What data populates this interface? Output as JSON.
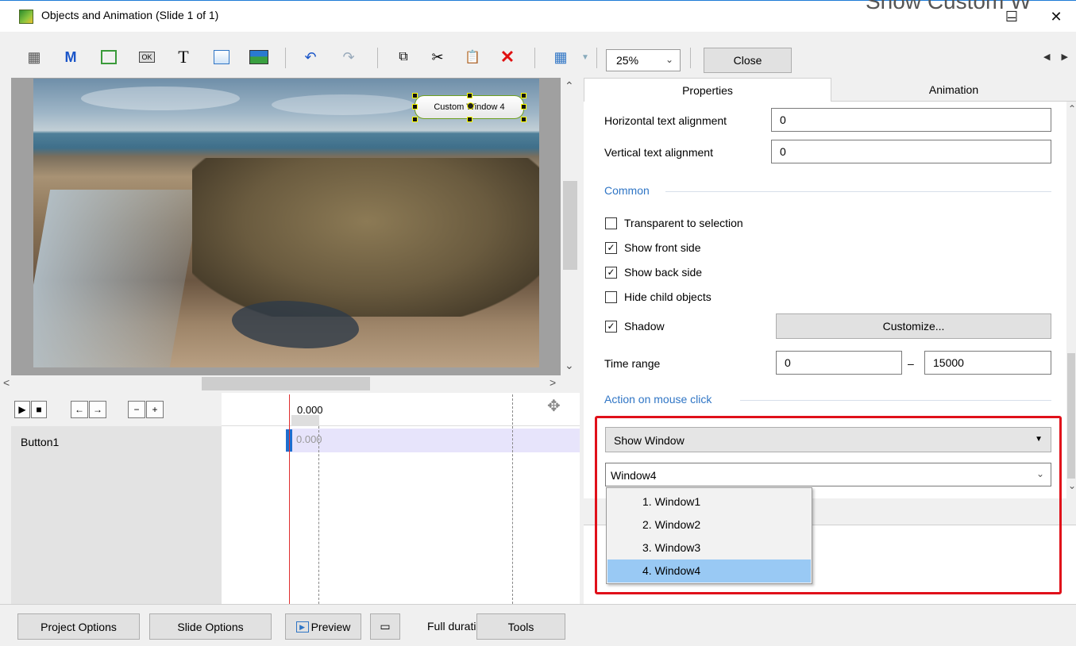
{
  "window": {
    "title": "Objects and Animation (Slide 1 of 1)",
    "minimize_glyph": "–",
    "maximize_glyph": "☐",
    "close_glyph": "✕",
    "background_app_text": "Show Custom W"
  },
  "toolbar": {
    "icons": [
      "camera-icon",
      "m-icon",
      "frame-icon",
      "ok-button-icon",
      "text-icon",
      "rectangle-icon",
      "image-icon",
      "undo-icon",
      "redo-icon",
      "copy-icon",
      "cut-icon",
      "paste-icon",
      "delete-icon",
      "grid-icon"
    ],
    "m_label": "M",
    "t_label": "T",
    "ok_label": "OK",
    "zoom_value": "25%",
    "close_label": "Close"
  },
  "canvas": {
    "object_label": "Custom Window 4"
  },
  "timeline": {
    "time_value": "0.000",
    "row_time": "0.000",
    "rows": [
      "Button1"
    ]
  },
  "tabs": {
    "properties": "Properties",
    "animation": "Animation"
  },
  "properties": {
    "h_align_label": "Horizontal text alignment",
    "h_align_value": "0",
    "v_align_label": "Vertical text alignment",
    "v_align_value": "0",
    "common_section": "Common",
    "transparent_label": "Transparent to selection",
    "transparent_checked": false,
    "front_label": "Show front side",
    "front_checked": true,
    "back_label": "Show back side",
    "back_checked": true,
    "hide_child_label": "Hide child objects",
    "hide_child_checked": false,
    "shadow_label": "Shadow",
    "shadow_checked": true,
    "customize_label": "Customize...",
    "time_range_label": "Time range",
    "time_start": "0",
    "time_dash": "–",
    "time_end": "15000",
    "action_section": "Action on mouse click",
    "action_value": "Show Window",
    "window_value": "Window4",
    "window_options": [
      "1. Window1",
      "2. Window2",
      "3. Window3",
      "4. Window4"
    ],
    "selected_option_index": 3
  },
  "bottom": {
    "project_options": "Project Options",
    "slide_options": "Slide Options",
    "preview": "Preview",
    "full_duration": "Full duration",
    "tools": "Tools"
  },
  "colors": {
    "highlight_red": "#e0101a",
    "section_blue": "#2f75c5",
    "selected_item": "#99c9f4",
    "playhead": "#e03030"
  }
}
